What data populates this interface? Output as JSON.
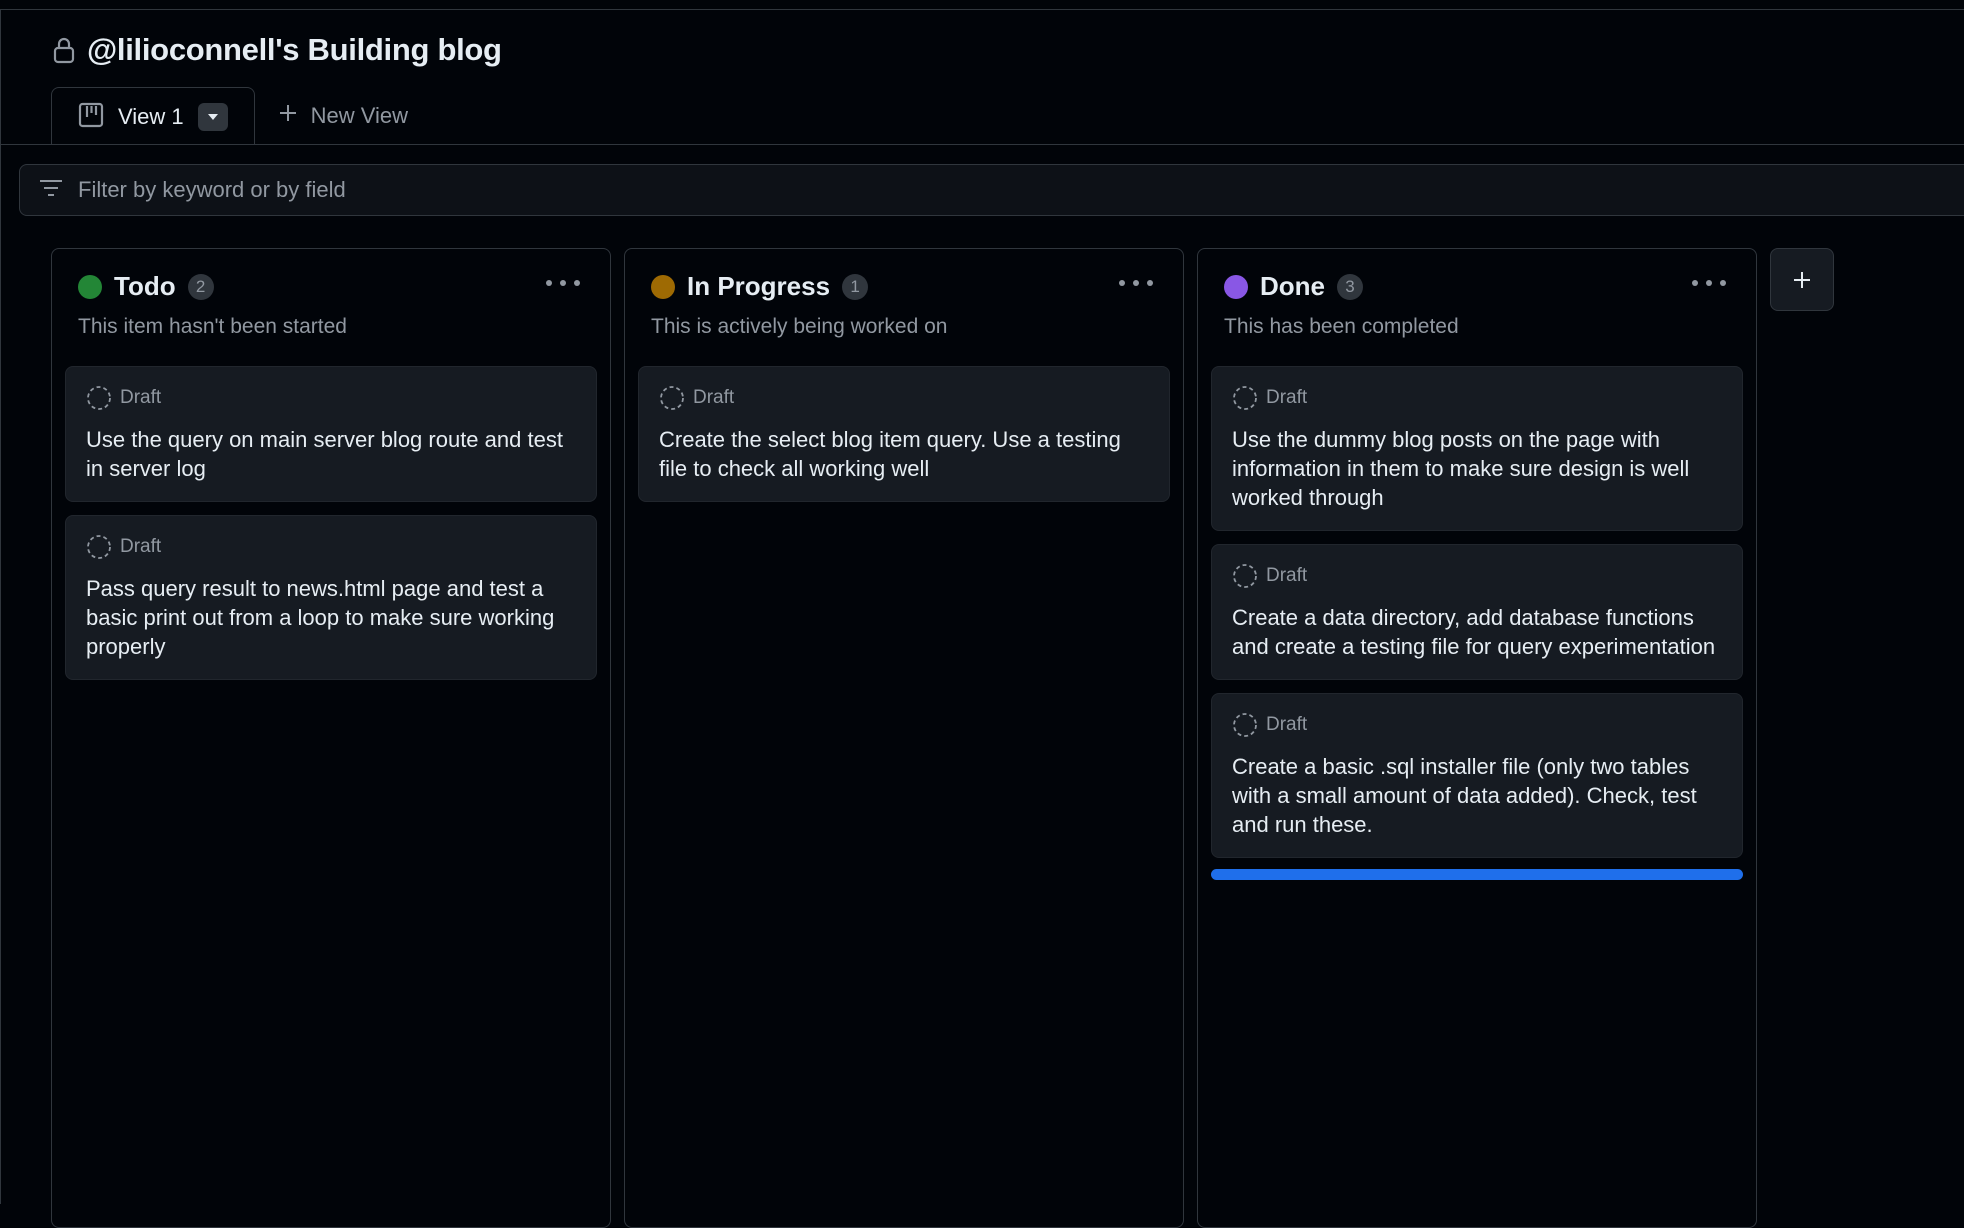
{
  "project": {
    "title": "@lilioconnell's Building blog"
  },
  "tabs": {
    "active_label": "View 1",
    "new_view_label": "New View"
  },
  "filter": {
    "placeholder": "Filter by keyword or by field"
  },
  "colors": {
    "todo": "#238636",
    "in_progress": "#9e6a03",
    "done": "#8957e5",
    "drop_indicator": "#1f6feb"
  },
  "columns": [
    {
      "name": "Todo",
      "count": "2",
      "description": "This item hasn't been started",
      "status_color": "#238636",
      "cards": [
        {
          "status": "Draft",
          "title": "Use the query on main server blog route and test in server log"
        },
        {
          "status": "Draft",
          "title": "Pass query result to news.html page and test a basic print out from a loop to make sure working properly"
        }
      ]
    },
    {
      "name": "In Progress",
      "count": "1",
      "description": "This is actively being worked on",
      "status_color": "#9e6a03",
      "cards": [
        {
          "status": "Draft",
          "title": "Create the select blog item query. Use a testing file to check all working well"
        }
      ]
    },
    {
      "name": "Done",
      "count": "3",
      "description": "This has been completed",
      "status_color": "#8957e5",
      "cards": [
        {
          "status": "Draft",
          "title": "Use the dummy blog posts on the page with information in them to make sure design is well worked through"
        },
        {
          "status": "Draft",
          "title": "Create a data directory, add database functions and create a testing file for query experimentation"
        },
        {
          "status": "Draft",
          "title": "Create a basic .sql installer file (only two tables with a small amount of data added). Check, test and run these."
        }
      ]
    }
  ],
  "icons": {
    "title": "lock-icon",
    "tab": "board-icon",
    "tab_menu": "triangle-down-icon",
    "new_view": "plus-icon",
    "filter": "filter-icon",
    "card_status": "draft-circle-icon",
    "column_menu": "kebab-horizontal-icon",
    "add_column": "plus-icon"
  }
}
